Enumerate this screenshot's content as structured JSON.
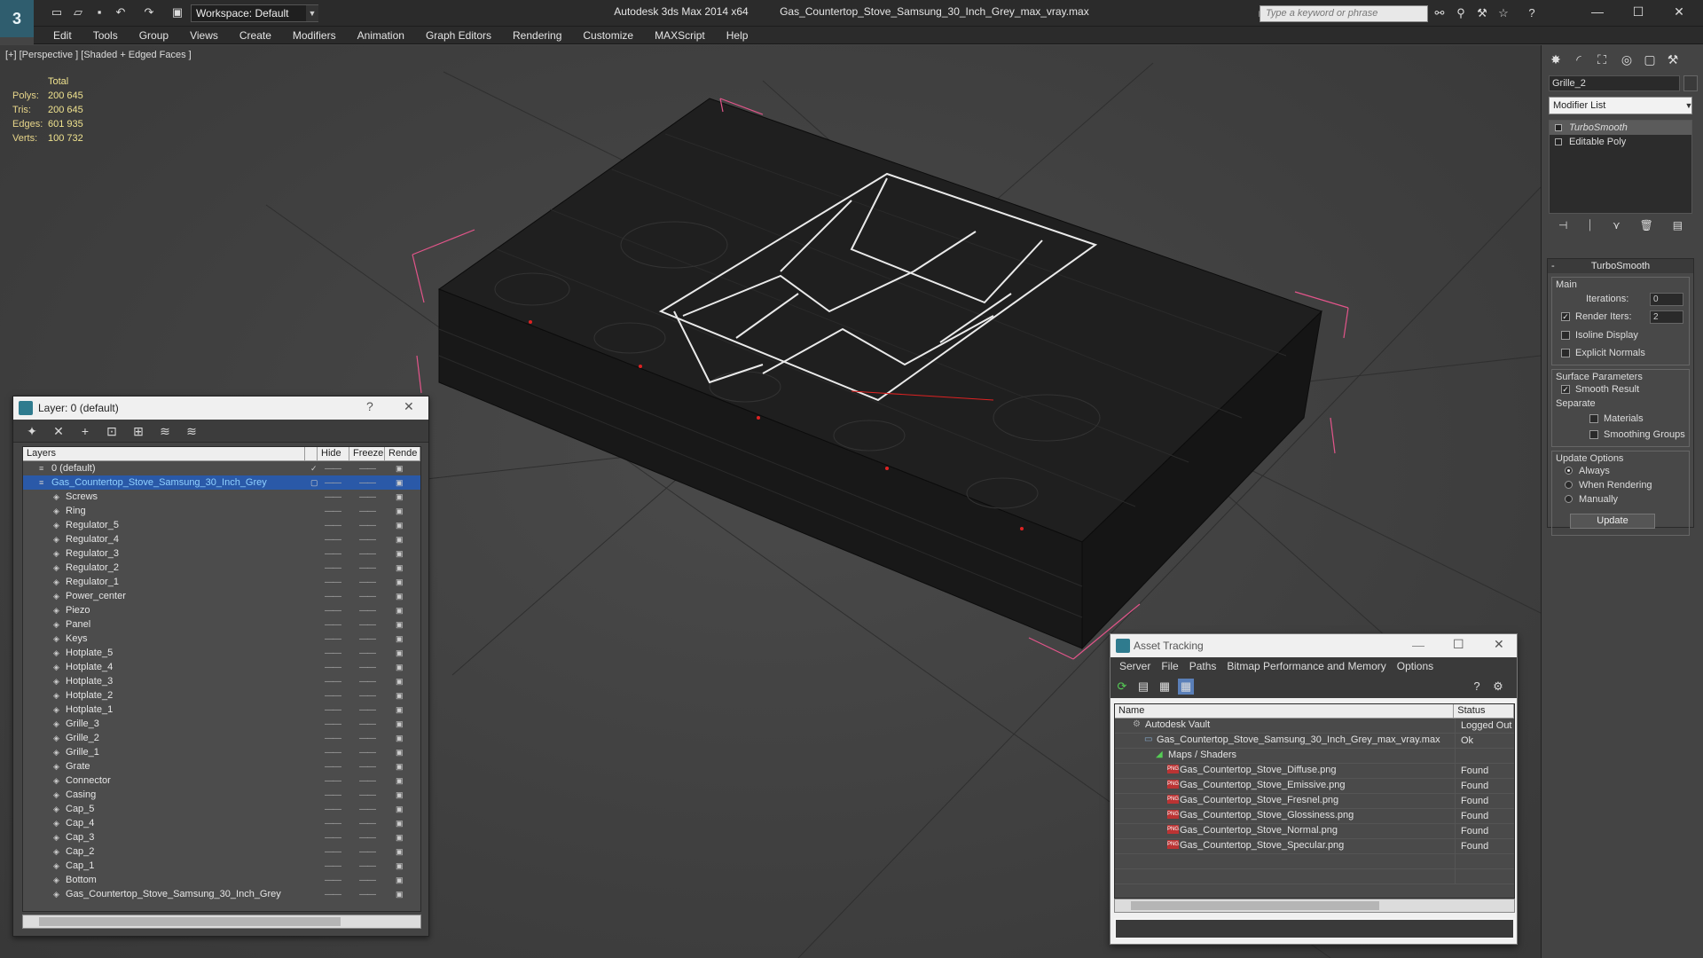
{
  "titlebar": {
    "workspace": "Workspace: Default",
    "app_name": "Autodesk 3ds Max  2014 x64",
    "file_name": "Gas_Countertop_Stove_Samsung_30_Inch_Grey_max_vray.max",
    "search_placeholder": "Type a keyword or phrase"
  },
  "menu": [
    "Edit",
    "Tools",
    "Group",
    "Views",
    "Create",
    "Modifiers",
    "Animation",
    "Graph Editors",
    "Rendering",
    "Customize",
    "MAXScript",
    "Help"
  ],
  "viewport": {
    "label": "[+] [Perspective ] [Shaded + Edged Faces ]",
    "stats": {
      "header": "Total",
      "rows": [
        {
          "label": "Polys:",
          "value": "200 645"
        },
        {
          "label": "Tris:",
          "value": "200 645"
        },
        {
          "label": "Edges:",
          "value": "601 935"
        },
        {
          "label": "Verts:",
          "value": "100 732"
        }
      ]
    }
  },
  "layer_panel": {
    "title": "Layer: 0 (default)",
    "help": "?",
    "close": "✕",
    "columns": [
      "Layers",
      "Hide",
      "Freeze",
      "Rende"
    ],
    "layers": [
      {
        "name": "0 (default)",
        "level": 0,
        "checked": true,
        "selected": false
      },
      {
        "name": "Gas_Countertop_Stove_Samsung_30_Inch_Grey",
        "level": 0,
        "checked": false,
        "selected": true
      }
    ],
    "objects": [
      "Screws",
      "Ring",
      "Regulator_5",
      "Regulator_4",
      "Regulator_3",
      "Regulator_2",
      "Regulator_1",
      "Power_center",
      "Piezo",
      "Panel",
      "Keys",
      "Hotplate_5",
      "Hotplate_4",
      "Hotplate_3",
      "Hotplate_2",
      "Hotplate_1",
      "Grille_3",
      "Grille_2",
      "Grille_1",
      "Grate",
      "Connector",
      "Casing",
      "Cap_5",
      "Cap_4",
      "Cap_3",
      "Cap_2",
      "Cap_1",
      "Bottom",
      "Gas_Countertop_Stove_Samsung_30_Inch_Grey"
    ]
  },
  "command_panel": {
    "object_name": "Grille_2",
    "modifier_list": "Modifier List",
    "stack": [
      {
        "name": "TurboSmooth",
        "selected": true
      },
      {
        "name": "Editable Poly",
        "selected": false
      }
    ],
    "turbosmooth": {
      "title": "TurboSmooth",
      "main_group": "Main",
      "iterations_label": "Iterations:",
      "iterations_value": "0",
      "render_iters_label": "Render Iters:",
      "render_iters_value": "2",
      "isoline_label": "Isoline Display",
      "explicit_normals_label": "Explicit Normals",
      "surface_group": "Surface Parameters",
      "smooth_result_label": "Smooth Result",
      "separate_label": "Separate",
      "materials_label": "Materials",
      "smoothing_groups_label": "Smoothing Groups",
      "update_group": "Update Options",
      "always_label": "Always",
      "when_rendering_label": "When Rendering",
      "manually_label": "Manually",
      "update_button": "Update"
    }
  },
  "asset_tracking": {
    "title": "Asset Tracking",
    "menu": [
      "Server",
      "File",
      "Paths",
      "Bitmap Performance and Memory",
      "Options"
    ],
    "columns": [
      "Name",
      "Status"
    ],
    "rows": [
      {
        "name": "Autodesk Vault",
        "status": "Logged Out",
        "indent": 0,
        "icon": "vault"
      },
      {
        "name": "Gas_Countertop_Stove_Samsung_30_Inch_Grey_max_vray.max",
        "status": "Ok",
        "indent": 1,
        "icon": "max"
      },
      {
        "name": "Maps / Shaders",
        "status": "",
        "indent": 2,
        "icon": "folder"
      },
      {
        "name": "Gas_Countertop_Stove_Diffuse.png",
        "status": "Found",
        "indent": 3,
        "icon": "png"
      },
      {
        "name": "Gas_Countertop_Stove_Emissive.png",
        "status": "Found",
        "indent": 3,
        "icon": "png"
      },
      {
        "name": "Gas_Countertop_Stove_Fresnel.png",
        "status": "Found",
        "indent": 3,
        "icon": "png"
      },
      {
        "name": "Gas_Countertop_Stove_Glossiness.png",
        "status": "Found",
        "indent": 3,
        "icon": "png"
      },
      {
        "name": "Gas_Countertop_Stove_Normal.png",
        "status": "Found",
        "indent": 3,
        "icon": "png"
      },
      {
        "name": "Gas_Countertop_Stove_Specular.png",
        "status": "Found",
        "indent": 3,
        "icon": "png"
      }
    ]
  }
}
